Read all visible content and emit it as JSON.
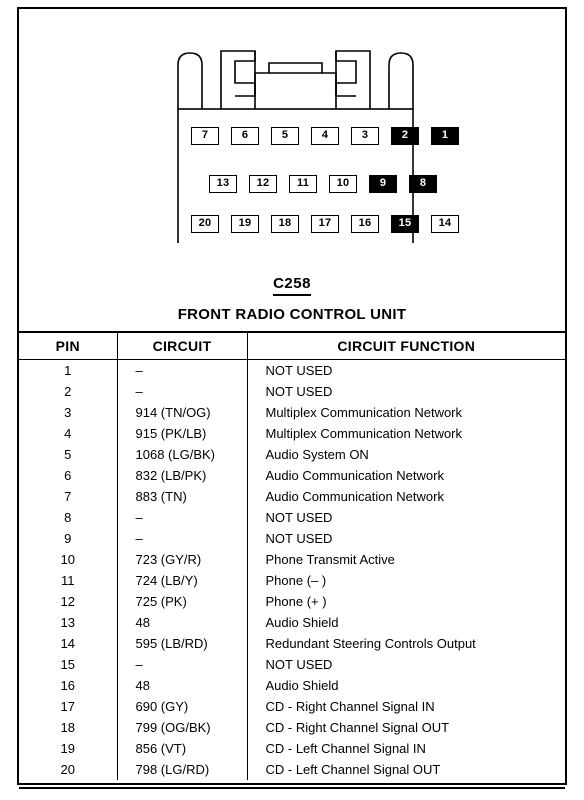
{
  "connector": {
    "id": "C258",
    "name": "FRONT RADIO CONTROL UNIT",
    "pin_rows": [
      {
        "row": 1,
        "pins": [
          {
            "label": "7",
            "filled": false
          },
          {
            "label": "6",
            "filled": false
          },
          {
            "label": "5",
            "filled": false
          },
          {
            "label": "4",
            "filled": false
          },
          {
            "label": "3",
            "filled": false
          },
          {
            "label": "2",
            "filled": true
          },
          {
            "label": "1",
            "filled": true
          }
        ]
      },
      {
        "row": 2,
        "pins": [
          {
            "label": "13",
            "filled": false
          },
          {
            "label": "12",
            "filled": false
          },
          {
            "label": "11",
            "filled": false
          },
          {
            "label": "10",
            "filled": false
          },
          {
            "label": "9",
            "filled": true
          },
          {
            "label": "8",
            "filled": true
          }
        ]
      },
      {
        "row": 3,
        "pins": [
          {
            "label": "20",
            "filled": false
          },
          {
            "label": "19",
            "filled": false
          },
          {
            "label": "18",
            "filled": false
          },
          {
            "label": "17",
            "filled": false
          },
          {
            "label": "16",
            "filled": false
          },
          {
            "label": "15",
            "filled": true
          },
          {
            "label": "14",
            "filled": false
          }
        ]
      }
    ]
  },
  "table": {
    "headers": {
      "pin": "PIN",
      "circuit": "CIRCUIT",
      "function": "CIRCUIT FUNCTION"
    },
    "rows": [
      {
        "pin": "1",
        "circuit": "–",
        "function": "NOT USED"
      },
      {
        "pin": "2",
        "circuit": "–",
        "function": "NOT USED"
      },
      {
        "pin": "3",
        "circuit": "914 (TN/OG)",
        "function": "Multiplex Communication Network"
      },
      {
        "pin": "4",
        "circuit": "915 (PK/LB)",
        "function": "Multiplex Communication Network"
      },
      {
        "pin": "5",
        "circuit": "1068 (LG/BK)",
        "function": "Audio System ON"
      },
      {
        "pin": "6",
        "circuit": "832 (LB/PK)",
        "function": "Audio Communication Network"
      },
      {
        "pin": "7",
        "circuit": "883 (TN)",
        "function": "Audio Communication Network"
      },
      {
        "pin": "8",
        "circuit": "–",
        "function": "NOT USED"
      },
      {
        "pin": "9",
        "circuit": "–",
        "function": "NOT USED"
      },
      {
        "pin": "10",
        "circuit": "723 (GY/R)",
        "function": "Phone Transmit Active"
      },
      {
        "pin": "11",
        "circuit": "724 (LB/Y)",
        "function": "Phone (– )"
      },
      {
        "pin": "12",
        "circuit": "725 (PK)",
        "function": "Phone (+ )"
      },
      {
        "pin": "13",
        "circuit": "48",
        "function": "Audio Shield"
      },
      {
        "pin": "14",
        "circuit": "595 (LB/RD)",
        "function": "Redundant Steering Controls Output"
      },
      {
        "pin": "15",
        "circuit": "–",
        "function": "NOT USED"
      },
      {
        "pin": "16",
        "circuit": "48",
        "function": "Audio Shield"
      },
      {
        "pin": "17",
        "circuit": "690 (GY)",
        "function": "CD -  Right Channel Signal IN"
      },
      {
        "pin": "18",
        "circuit": "799 (OG/BK)",
        "function": "CD -  Right Channel Signal OUT"
      },
      {
        "pin": "19",
        "circuit": "856 (VT)",
        "function": "CD -  Left Channel Signal IN"
      },
      {
        "pin": "20",
        "circuit": "798 (LG/RD)",
        "function": "CD -  Left Channel Signal OUT"
      }
    ]
  },
  "colors": {
    "ink": "#000000",
    "paper": "#ffffff"
  }
}
